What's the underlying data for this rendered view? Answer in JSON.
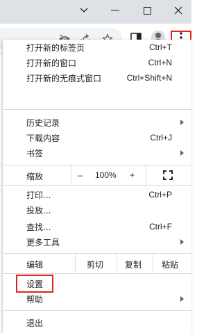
{
  "window_controls": {
    "minimize": "minimize-icon",
    "maximize": "maximize-icon",
    "close": "close-icon",
    "tab_search": "chevron-down-icon"
  },
  "toolbar_icons": [
    "eye-off-icon",
    "share-icon",
    "star-icon",
    "side-panel-icon",
    "profile-avatar-icon",
    "more-vert-icon"
  ],
  "colors": {
    "highlight": "#e0241a",
    "titlebar": "#dee1e6",
    "separator": "#dadce0"
  },
  "menu": {
    "new_tab": {
      "label": "打开新的标签页",
      "shortcut": "Ctrl+T"
    },
    "new_window": {
      "label": "打开新的窗口",
      "shortcut": "Ctrl+N"
    },
    "new_incognito": {
      "label": "打开新的无痕式窗口",
      "shortcut": "Ctrl+Shift+N"
    },
    "history": {
      "label": "历史记录"
    },
    "downloads": {
      "label": "下载内容",
      "shortcut": "Ctrl+J"
    },
    "bookmarks": {
      "label": "书签"
    },
    "zoom": {
      "label": "缩放",
      "minus": "–",
      "value": "100%",
      "plus": "+"
    },
    "print": {
      "label": "打印...",
      "shortcut": "Ctrl+P"
    },
    "cast": {
      "label": "投放..."
    },
    "find": {
      "label": "查找...",
      "shortcut": "Ctrl+F"
    },
    "more_tools": {
      "label": "更多工具"
    },
    "edit": {
      "label": "编辑",
      "cut": "剪切",
      "copy": "复制",
      "paste": "粘贴"
    },
    "settings": {
      "label": "设置"
    },
    "help": {
      "label": "帮助"
    },
    "exit": {
      "label": "退出"
    }
  }
}
